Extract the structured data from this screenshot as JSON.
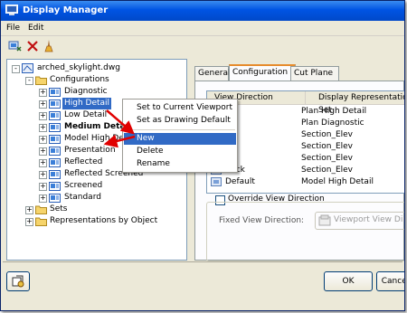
{
  "window": {
    "title": "Display Manager"
  },
  "menu": {
    "file": "File",
    "edit": "Edit"
  },
  "toolbar": {
    "icons": [
      "new-style-icon",
      "delete-icon",
      "purge-icon"
    ]
  },
  "tree": {
    "root": "arched_skylight.dwg",
    "configurations": "Configurations",
    "items": [
      "Diagnostic",
      "High Detail",
      "Low Detail",
      "Medium Detail",
      "Model High Detail",
      "Presentation",
      "Reflected",
      "Reflected Screened",
      "Screened",
      "Standard"
    ],
    "bold_item": "Medium Detail",
    "selected_item": "High Detail",
    "sets": "Sets",
    "representations": "Representations by Object"
  },
  "tabs": [
    "General",
    "Configuration",
    "Cut Plane"
  ],
  "active_tab": "Configuration",
  "view_table": {
    "headers": [
      "View Direction",
      "Display Representation Set"
    ],
    "rows": [
      {
        "view": "",
        "set": "Plan High Detail"
      },
      {
        "view": "om",
        "set": "Plan Diagnostic"
      },
      {
        "view": "",
        "set": "Section_Elev"
      },
      {
        "view": "nt",
        "set": "Section_Elev"
      },
      {
        "view": "nt",
        "set": "Section_Elev"
      },
      {
        "view": "Back",
        "set": "Section_Elev"
      },
      {
        "view": "Default",
        "set": "Model High Detail"
      }
    ]
  },
  "override": {
    "label": "Override View Direction",
    "fixed_label": "Fixed View Direction:",
    "fixed_button": "Viewport View Directio"
  },
  "context_menu": {
    "items": [
      "Set to Current Viewport",
      "Set as Drawing Default",
      "New",
      "Delete",
      "Rename"
    ],
    "highlighted": "New"
  },
  "buttons": {
    "ok": "OK",
    "cancel": "Cancel"
  },
  "colors": {
    "title": "#0054e3",
    "selection": "#316ac5",
    "arrow": "#e00000",
    "tab_accent": "#e68b2c"
  }
}
